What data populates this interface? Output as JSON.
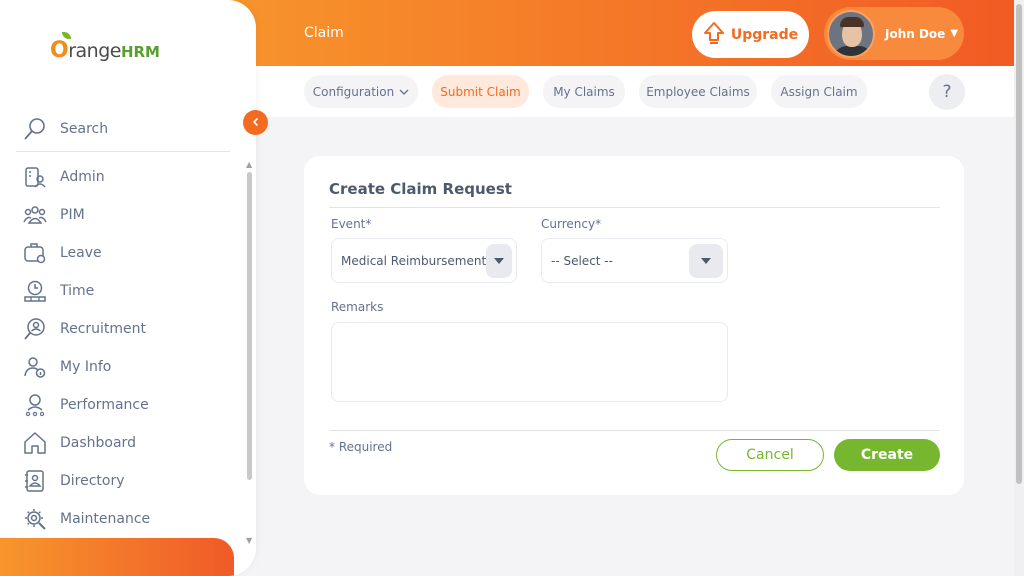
{
  "brand": {
    "name_o": "O",
    "name_range": "range",
    "name_hrm": "HRM"
  },
  "header": {
    "title": "Claim",
    "upgrade_label": "Upgrade",
    "user_name": "John Doe"
  },
  "sidebar": {
    "search_label": "Search",
    "items": [
      {
        "label": "Admin",
        "icon": "admin-icon"
      },
      {
        "label": "PIM",
        "icon": "pim-icon"
      },
      {
        "label": "Leave",
        "icon": "leave-icon"
      },
      {
        "label": "Time",
        "icon": "time-icon"
      },
      {
        "label": "Recruitment",
        "icon": "recruitment-icon"
      },
      {
        "label": "My Info",
        "icon": "my-info-icon"
      },
      {
        "label": "Performance",
        "icon": "performance-icon"
      },
      {
        "label": "Dashboard",
        "icon": "dashboard-icon"
      },
      {
        "label": "Directory",
        "icon": "directory-icon"
      },
      {
        "label": "Maintenance",
        "icon": "maintenance-icon"
      }
    ]
  },
  "tabs": [
    {
      "label": "Configuration",
      "active": false,
      "has_dropdown": true
    },
    {
      "label": "Submit Claim",
      "active": true
    },
    {
      "label": "My Claims",
      "active": false
    },
    {
      "label": "Employee Claims",
      "active": false
    },
    {
      "label": "Assign Claim",
      "active": false
    }
  ],
  "help_label": "?",
  "form": {
    "title": "Create Claim Request",
    "event_label": "Event*",
    "event_value": "Medical Reimbursement",
    "currency_label": "Currency*",
    "currency_value": "-- Select --",
    "remarks_label": "Remarks",
    "remarks_value": "",
    "required_note": "* Required",
    "cancel_label": "Cancel",
    "create_label": "Create"
  },
  "colors": {
    "accent": "#f26b21",
    "header_gradient_start": "#f7962c",
    "header_gradient_end": "#f15a24",
    "success": "#76b72f",
    "active_tab_bg": "#ffe9dd"
  }
}
